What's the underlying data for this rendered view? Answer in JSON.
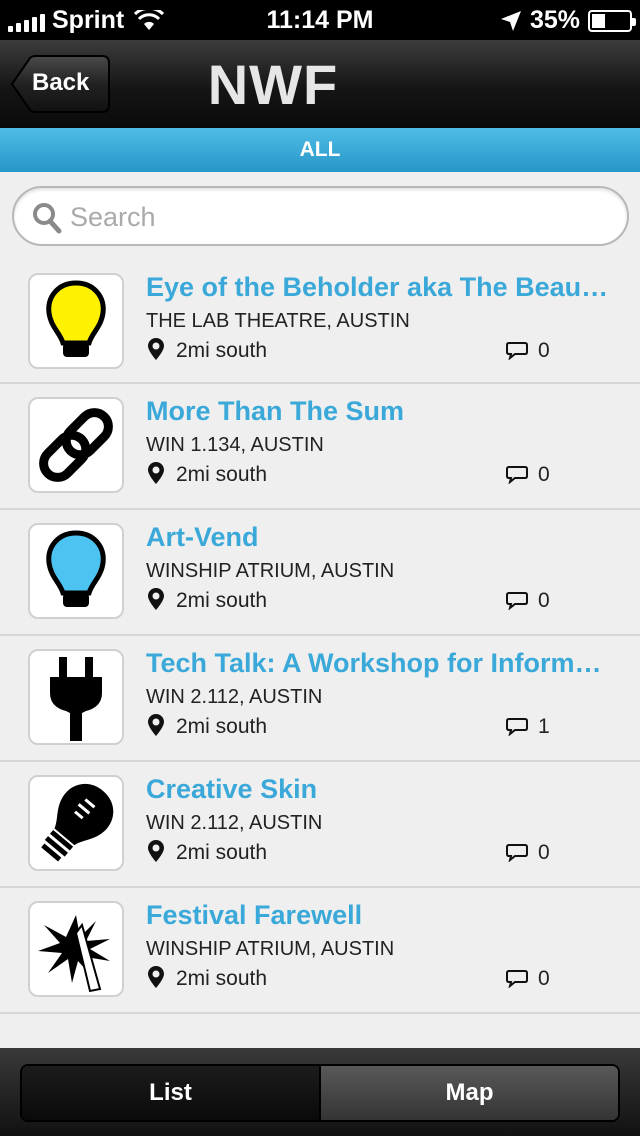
{
  "status_bar": {
    "carrier": "Sprint",
    "time": "11:14 PM",
    "battery": "35%",
    "battery_level": 0.35
  },
  "nav": {
    "back_label": "Back",
    "title": "NWF"
  },
  "filter": {
    "label": "ALL"
  },
  "search": {
    "placeholder": "Search",
    "value": ""
  },
  "events": [
    {
      "title": "Eye of the Beholder aka The Beauty of Improv",
      "venue": "THE LAB THEATRE, AUSTIN",
      "distance": "2mi south",
      "comments": "0",
      "icon": "yellow-bulb-icon"
    },
    {
      "title": "More Than The Sum",
      "venue": "WIN 1.134, AUSTIN",
      "distance": "2mi south",
      "comments": "0",
      "icon": "chain-link-icon"
    },
    {
      "title": "Art-Vend",
      "venue": "WINSHIP ATRIUM, AUSTIN",
      "distance": "2mi south",
      "comments": "0",
      "icon": "blue-bulb-icon"
    },
    {
      "title": "Tech Talk: A Workshop for Information",
      "venue": "WIN 2.112, AUSTIN",
      "distance": "2mi south",
      "comments": "1",
      "icon": "plug-icon"
    },
    {
      "title": "Creative Skin",
      "venue": "WIN 2.112, AUSTIN",
      "distance": "2mi south",
      "comments": "0",
      "icon": "black-bulb-icon"
    },
    {
      "title": "Festival Farewell",
      "venue": "WINSHIP ATRIUM, AUSTIN",
      "distance": "2mi south",
      "comments": "0",
      "icon": "burst-icon"
    }
  ],
  "tabs": {
    "list_label": "List",
    "map_label": "Map"
  },
  "colors": {
    "accent_blue": "#3aa9d9",
    "filter_bar": "#2796c8",
    "bulb_yellow": "#fff200",
    "bulb_blue": "#4cc3f0"
  }
}
